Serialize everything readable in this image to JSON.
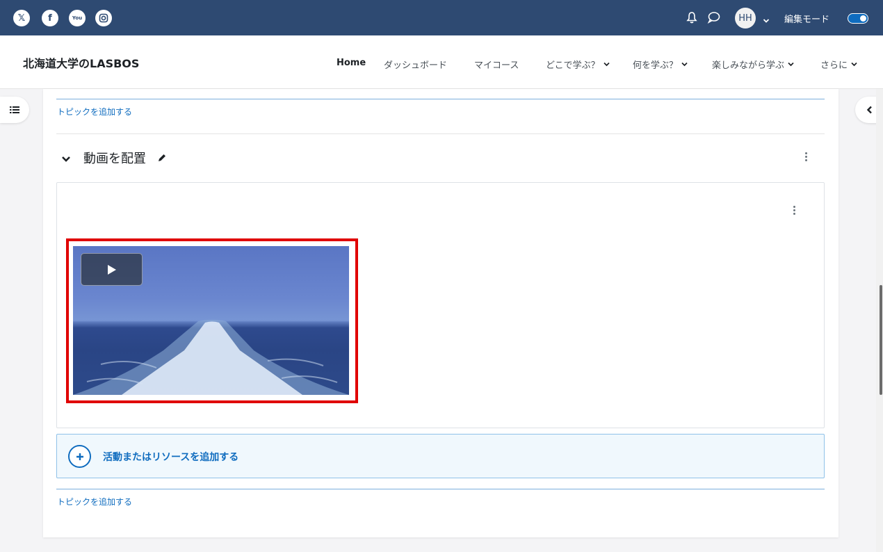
{
  "topbar": {
    "social": [
      {
        "name": "x",
        "glyph": "𝕏"
      },
      {
        "name": "facebook",
        "glyph": "f"
      },
      {
        "name": "youtube",
        "glyph": "You"
      },
      {
        "name": "instagram",
        "glyph": ""
      }
    ],
    "avatar_initials": "HH",
    "edit_mode_label": "編集モード",
    "edit_mode_on": true
  },
  "navbar": {
    "brand": "北海道大学のLASBOS",
    "items": [
      {
        "label": "Home",
        "dropdown": false
      },
      {
        "label": "ダッシュボード",
        "dropdown": false
      },
      {
        "label": "マイコース",
        "dropdown": false
      },
      {
        "label": "どこで学ぶ？",
        "dropdown": true
      },
      {
        "label": "何を学ぶ？",
        "dropdown": true
      },
      {
        "label": "楽しみながら学ぶ",
        "dropdown": true
      },
      {
        "label": "さらに",
        "dropdown": true
      }
    ]
  },
  "course": {
    "add_topic_label": "トピックを追加する",
    "section_title": "動画を配置",
    "add_activity_label": "活動またはリソースを追加する"
  },
  "colors": {
    "topbar": "#2e4a72",
    "link": "#0f6cbf",
    "highlight_frame": "#e00000"
  }
}
